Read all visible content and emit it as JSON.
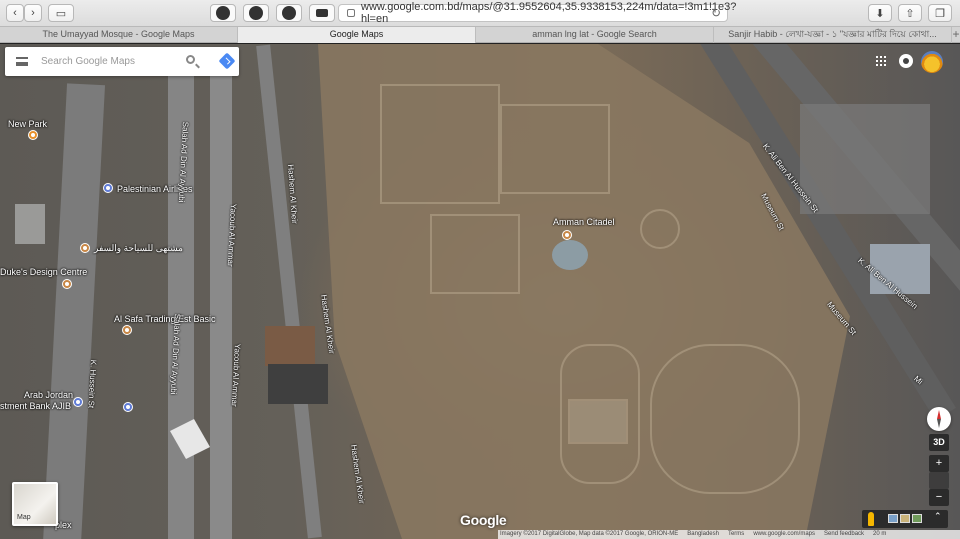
{
  "browser": {
    "url": "www.google.com.bd/maps/@31.9552604,35.9338153,224m/data=!3m1!1e3?hl=en",
    "buttons": [
      "back-icon",
      "forward-icon",
      "sidebar-icon",
      "download-icon",
      "share-icon",
      "tabs-icon"
    ]
  },
  "tabs": [
    {
      "label": "The Umayyad Mosque - Google Maps",
      "active": false
    },
    {
      "label": "Google Maps",
      "active": true
    },
    {
      "label": "amman lng lat - Google Search",
      "active": false
    },
    {
      "label": "Sanjir Habib - লেখা-যজ্ঞা - ১ \"যজ্ঞার মাটির দিয়ে কোথা...",
      "active": false
    }
  ],
  "search": {
    "placeholder": "Search Google Maps",
    "value": ""
  },
  "map": {
    "logo": "Google",
    "layer_label": "Map",
    "controls": {
      "three_d": "3D",
      "zoom_in": "+",
      "zoom_out": "−",
      "expand": "⌃"
    },
    "places": [
      {
        "name": "New Park"
      },
      {
        "name": "Palestinian Airlines"
      },
      {
        "name": "مشتهى للسياحة والسفر"
      },
      {
        "name": "Duke's Design Centre"
      },
      {
        "name": "Al Safa Trading Est Basic"
      },
      {
        "name": "Arab Jordan"
      },
      {
        "name": "stment Bank AJIB"
      },
      {
        "name": "Amman Citadel"
      },
      {
        "name": "plex"
      }
    ],
    "streets": [
      {
        "name": "Salah Ad Din Al Ayyubi"
      },
      {
        "name": "Yacoub Al Ammar"
      },
      {
        "name": "Hashem Al Kheir"
      },
      {
        "name": "Hashem Al Kheir"
      },
      {
        "name": "Hashem Al Kheir"
      },
      {
        "name": "Salah Ad Din Al Ayyubi"
      },
      {
        "name": "Yacoub Al Ammar"
      },
      {
        "name": "K. Hussein St"
      },
      {
        "name": "K. Ali Ben Al Hussein St"
      },
      {
        "name": "Museum St"
      },
      {
        "name": "K. Ali Ben Al Hussein"
      },
      {
        "name": "Museum St"
      },
      {
        "name": "Mi"
      }
    ],
    "footer": [
      "Imagery ©2017 DigitalGlobe, Map data ©2017 Google, ORION-ME",
      "Bangladesh",
      "Terms",
      "www.google.com/maps",
      "Send feedback",
      "20 m"
    ]
  }
}
